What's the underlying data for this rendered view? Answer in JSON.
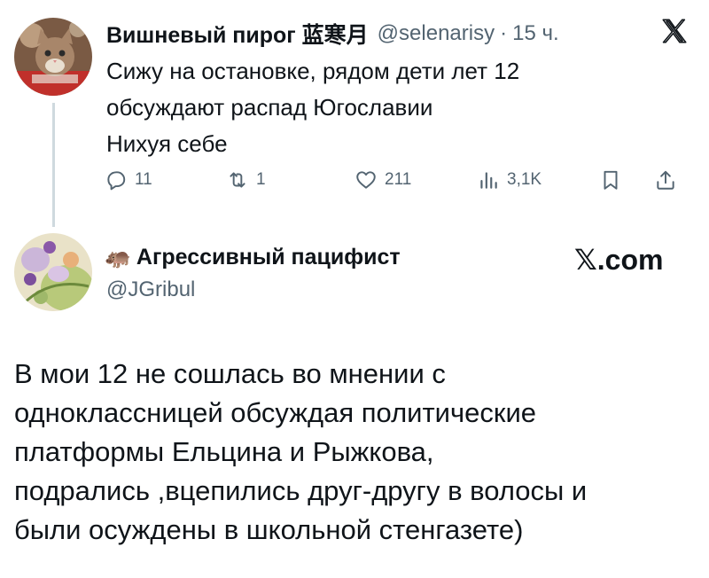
{
  "tweet1": {
    "author": {
      "display_name": "Вишневый пирог 蓝寒月",
      "handle": "@selenarisy",
      "separator": "·",
      "time": "15 ч."
    },
    "text_lines": [
      "Сижу на остановке, рядом дети лет 12",
      "обсуждают распад Югославии",
      "Нихуя себе"
    ],
    "actions": {
      "replies": "11",
      "reposts": "1",
      "likes": "211",
      "views": "3,1K"
    }
  },
  "tweet2": {
    "author": {
      "emoji": "🦛",
      "display_name": "Агрессивный пацифист",
      "handle": "@JGribul"
    },
    "brand": "𝕏.com",
    "text_lines": [
      "В мои 12 не сошлась во мнении с",
      "одноклассницей обсуждая политические",
      "платформы Ельцина и Рыжкова,",
      "подрались ,вцепились друг-другу в волосы и",
      "были осуждены в школьной стенгазете)"
    ]
  },
  "colors": {
    "text": "#0f1419",
    "secondary": "#536471",
    "thread_line": "#cfd9de"
  }
}
